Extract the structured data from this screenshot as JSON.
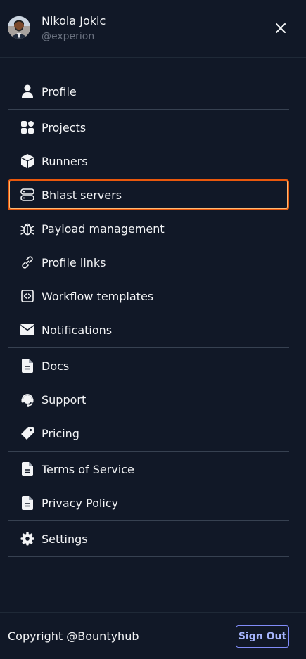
{
  "user": {
    "name": "Nikola Jokic",
    "handle": "@experion"
  },
  "menu": {
    "profile": {
      "label": "Profile",
      "icon": "user-icon"
    },
    "projects": {
      "label": "Projects",
      "icon": "grid-icon"
    },
    "runners": {
      "label": "Runners",
      "icon": "cube-icon"
    },
    "bhlast": {
      "label": "Bhlast servers",
      "icon": "server-icon"
    },
    "payload": {
      "label": "Payload management",
      "icon": "bug-icon"
    },
    "links": {
      "label": "Profile links",
      "icon": "link-icon"
    },
    "workflow": {
      "label": "Workflow templates",
      "icon": "code-icon"
    },
    "notifications": {
      "label": "Notifications",
      "icon": "envelope-icon"
    },
    "docs": {
      "label": "Docs",
      "icon": "document-icon"
    },
    "support": {
      "label": "Support",
      "icon": "headset-icon"
    },
    "pricing": {
      "label": "Pricing",
      "icon": "tag-icon"
    },
    "terms": {
      "label": "Terms of Service",
      "icon": "document-icon"
    },
    "privacy": {
      "label": "Privacy Policy",
      "icon": "document-icon"
    },
    "settings": {
      "label": "Settings",
      "icon": "gear-icon"
    }
  },
  "active_item": "Bhlast servers",
  "footer": {
    "copyright": "Copyright @Bountyhub",
    "signout_label": "Sign Out"
  },
  "colors": {
    "background": "#111827",
    "active_border": "#ea580c",
    "signout_accent": "#818cf8",
    "divider": "#374151"
  }
}
